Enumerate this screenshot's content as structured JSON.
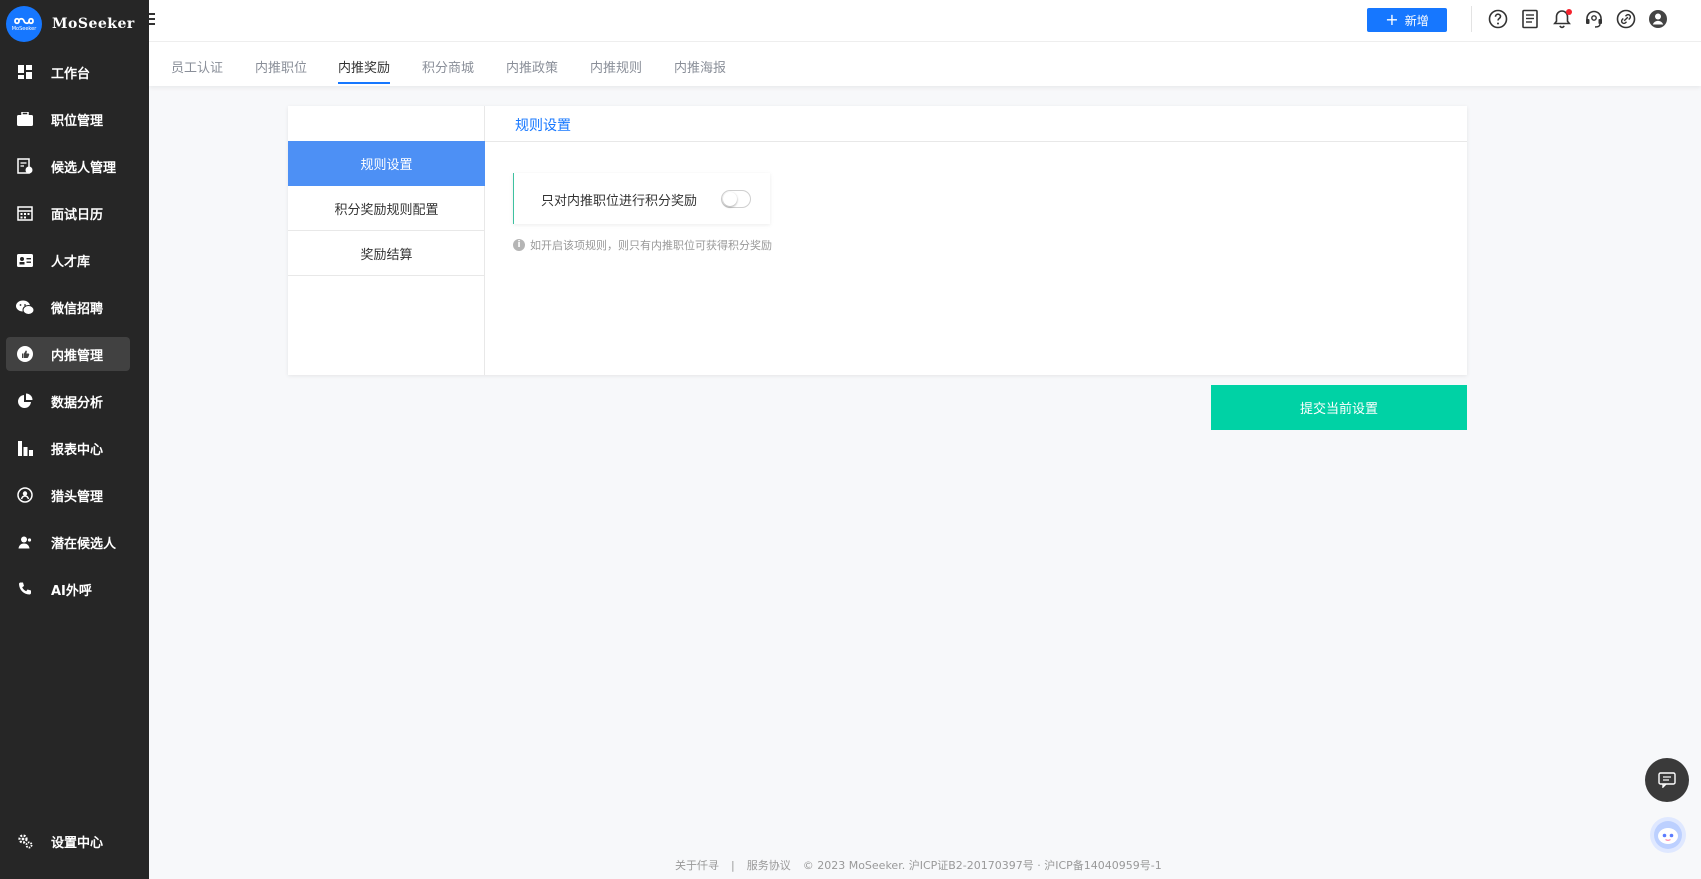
{
  "brand": {
    "name": "MoSeeker",
    "logo_small_text": "MoSeeker"
  },
  "sidebar": {
    "items": [
      {
        "label": "工作台",
        "icon": "dashboard-icon"
      },
      {
        "label": "职位管理",
        "icon": "briefcase-icon"
      },
      {
        "label": "候选人管理",
        "icon": "candidate-file-icon"
      },
      {
        "label": "面试日历",
        "icon": "calendar-icon"
      },
      {
        "label": "人才库",
        "icon": "id-card-icon"
      },
      {
        "label": "微信招聘",
        "icon": "wechat-icon"
      },
      {
        "label": "内推管理",
        "icon": "thumbs-up-icon",
        "active": true
      },
      {
        "label": "数据分析",
        "icon": "pie-chart-icon"
      },
      {
        "label": "报表中心",
        "icon": "bar-chart-icon"
      },
      {
        "label": "猎头管理",
        "icon": "headhunter-icon"
      },
      {
        "label": "潜在候选人",
        "icon": "person-icon"
      },
      {
        "label": "AI外呼",
        "icon": "phone-icon"
      }
    ],
    "settings": {
      "label": "设置中心",
      "icon": "gear-icon"
    }
  },
  "header": {
    "add_button": "新增",
    "icons": [
      "help-icon",
      "document-icon",
      "bell-icon",
      "headset-icon",
      "link-icon",
      "user-avatar-icon"
    ]
  },
  "tabs": [
    {
      "label": "员工认证"
    },
    {
      "label": "内推职位"
    },
    {
      "label": "内推奖励",
      "active": true
    },
    {
      "label": "积分商城"
    },
    {
      "label": "内推政策"
    },
    {
      "label": "内推规则"
    },
    {
      "label": "内推海报"
    }
  ],
  "left_menu": [
    {
      "label": "规则设置",
      "active": true
    },
    {
      "label": "积分奖励规则配置"
    },
    {
      "label": "奖励结算"
    }
  ],
  "content": {
    "title": "规则设置",
    "rule_label": "只对内推职位进行积分奖励",
    "rule_enabled": false,
    "hint_icon": "i",
    "hint": "如开启该项规则，则只有内推职位可获得积分奖励"
  },
  "submit_button": "提交当前设置",
  "footer": {
    "about": "关于仟寻",
    "separator": "|",
    "terms": "服务协议",
    "copyright": "© 2023 MoSeeker. 沪ICP证B2-20170397号 · 沪ICP备14040959号-1"
  },
  "colors": {
    "sidebar_bg": "#262626",
    "primary": "#1677ff",
    "menu_active": "#4d90f5",
    "submit": "#00d2a5"
  }
}
